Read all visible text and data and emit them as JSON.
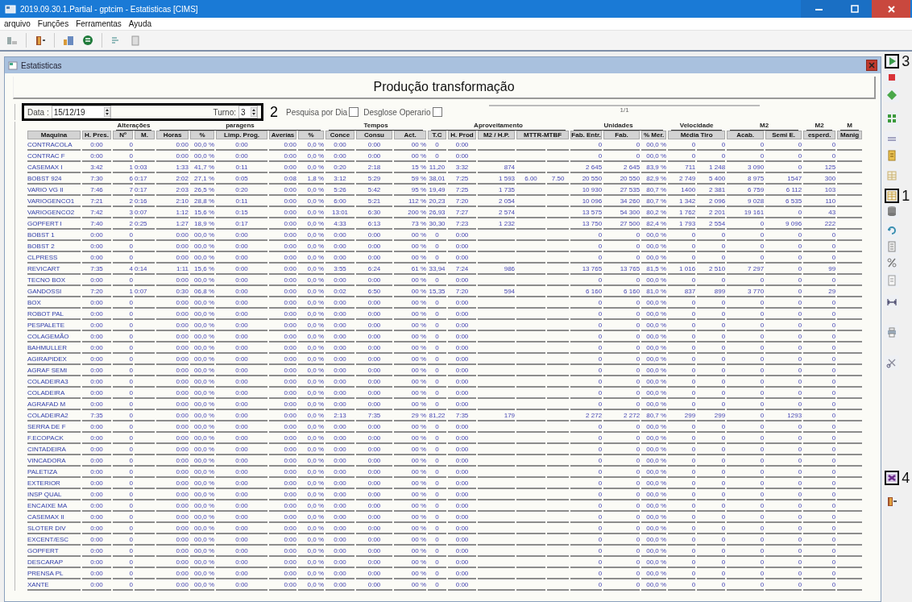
{
  "window": {
    "title": "2019.09.30.1.Partial - gptcim - Estatisticas [CIMS]"
  },
  "menu": [
    "arquivo",
    "Funções",
    "Ferramentas",
    "Ayuda"
  ],
  "child_window": {
    "title": "Estatisticas",
    "heading": "Produção transformação"
  },
  "filters": {
    "date_label": "Data :",
    "date_value": "15/12/19",
    "shift_label": "Turno:",
    "shift_value": "3",
    "highlighted": true,
    "callout": "2",
    "search_by_day": {
      "label": "Pesquisa por Dia",
      "checked": false
    },
    "operator_breakdown": {
      "label": "Desglose Operario",
      "checked": false
    },
    "page": "1/1"
  },
  "table": {
    "groups": [
      {
        "columns": [
          {
            "label": "Maquina"
          },
          {
            "label": "H. Pres."
          }
        ]
      },
      {
        "label": "Alterações",
        "columns": [
          {
            "label": "Nº"
          },
          {
            "label": "M."
          }
        ]
      },
      {
        "label": "paragens",
        "columns": [
          {
            "label": "Horas"
          },
          {
            "label": "%"
          },
          {
            "label": "Limp. Prog."
          },
          {
            "label": "Averías"
          },
          {
            "label": "%"
          }
        ]
      },
      {
        "label": "Tempos",
        "columns": [
          {
            "label": "Conce"
          },
          {
            "label": "Consu"
          },
          {
            "label": "Act."
          }
        ]
      },
      {
        "label": "Aproveitamento",
        "columns": [
          {
            "label": "T.C"
          },
          {
            "label": "H. Prod"
          },
          {
            "label": "M2 / H.P."
          },
          {
            "label": "MTTR-MTBF",
            "kind": "pair"
          }
        ]
      },
      {
        "label": "Unidades",
        "columns": [
          {
            "label": "Fab. Entr."
          },
          {
            "label": "Fab."
          },
          {
            "label": "% Mer."
          }
        ]
      },
      {
        "label": "Velocidade",
        "columns": [
          {
            "label": "Média Tiro",
            "kind": "pair"
          }
        ]
      },
      {
        "label": "M2",
        "columns": [
          {
            "label": "Acab."
          },
          {
            "label": "Semi E."
          }
        ]
      },
      {
        "label": "M2",
        "columns": [
          {
            "label": "esperd."
          }
        ]
      },
      {
        "label": "M",
        "columns": [
          {
            "label": "Manig"
          }
        ]
      }
    ],
    "rows": [
      [
        "CONTRACOLA",
        "0:00",
        "0",
        null,
        "0:00",
        "00,0 %",
        "0:00",
        "0:00",
        "0,0 %",
        "0:00",
        "0:00",
        "00 %",
        "0",
        "0:00",
        null,
        null,
        null,
        "0",
        "0",
        "00,0 %",
        "0",
        "0",
        "0",
        "0",
        "0"
      ],
      [
        "CONTRAC F",
        "0:00",
        "0",
        null,
        "0:00",
        "00,0 %",
        "0:00",
        "0:00",
        "0,0 %",
        "0:00",
        "0:00",
        "00 %",
        "0",
        "0:00",
        null,
        null,
        null,
        "0",
        "0",
        "00,0 %",
        "0",
        "0",
        "0",
        "0",
        "0"
      ],
      [
        "CASEMAX I",
        "3:42",
        "1",
        "0:03",
        "1:33",
        "41,7 %",
        "0:11",
        "0:00",
        "0,0 %",
        "0:20",
        "2:18",
        "15 %",
        "11,20",
        "3:32",
        "874",
        null,
        null,
        "2 645",
        "2 645",
        "83,9 %",
        "711",
        "1 248",
        "3 090",
        "0",
        "125"
      ],
      [
        "BOBST 924",
        "7:30",
        "6",
        "0:17",
        "2:02",
        "27,1 %",
        "0:05",
        "0:08",
        "1,8 %",
        "3:12",
        "5:29",
        "59 %",
        "38,01",
        "7:25",
        "1 593",
        "6.00",
        "7.50",
        "20 550",
        "20 550",
        "82,9 %",
        "2 749",
        "5 400",
        "8 975",
        "1547",
        "300"
      ],
      [
        "VARIO VG II",
        "7:46",
        "7",
        "0:17",
        "2:03",
        "26,5 %",
        "0:20",
        "0:00",
        "0,0 %",
        "5:26",
        "5:42",
        "95 %",
        "19,49",
        "7:25",
        "1 735",
        null,
        null,
        "10 930",
        "27 535",
        "80,7 %",
        "1400",
        "2 381",
        "6 759",
        "6 112",
        "103"
      ],
      [
        "VARIOGENCO1",
        "7:21",
        "2",
        "0:16",
        "2:10",
        "28,8 %",
        "0:11",
        "0:00",
        "0,0 %",
        "6:00",
        "5:21",
        "112 %",
        "20,23",
        "7:20",
        "2 054",
        null,
        null,
        "10 096",
        "34 260",
        "80,7 %",
        "1 342",
        "2 096",
        "9 028",
        "6 535",
        "110"
      ],
      [
        "VARIOGENCO2",
        "7:42",
        "3",
        "0:07",
        "1:12",
        "15,6 %",
        "0:15",
        "0:00",
        "0,0 %",
        "13:01",
        "6:30",
        "200 %",
        "26,93",
        "7:27",
        "2 574",
        null,
        null,
        "13 575",
        "54 300",
        "80,2 %",
        "1 762",
        "2 201",
        "19 161",
        "0",
        "43"
      ],
      [
        "GOPFERT I",
        "7:40",
        "2",
        "0:25",
        "1:27",
        "18,9 %",
        "0:17",
        "0:00",
        "0,0 %",
        "4:33",
        "6:13",
        "73 %",
        "30,30",
        "7:23",
        "1 232",
        null,
        null,
        "13 750",
        "27 500",
        "82,4 %",
        "1 793",
        "2 554",
        "0",
        "9 096",
        "222"
      ],
      [
        "BOBST 1",
        "0:00",
        "0",
        null,
        "0:00",
        "00,0 %",
        "0:00",
        "0:00",
        "0,0 %",
        "0:00",
        "0:00",
        "00 %",
        "0",
        "0:00",
        null,
        null,
        null,
        "0",
        "0",
        "00,0 %",
        "0",
        "0",
        "0",
        "0",
        "0"
      ],
      [
        "BOBST 2",
        "0:00",
        "0",
        null,
        "0:00",
        "00,0 %",
        "0:00",
        "0:00",
        "0,0 %",
        "0:00",
        "0:00",
        "00 %",
        "0",
        "0:00",
        null,
        null,
        null,
        "0",
        "0",
        "00,0 %",
        "0",
        "0",
        "0",
        "0",
        "0"
      ],
      [
        "CLPRESS",
        "0:00",
        "0",
        null,
        "0:00",
        "00,0 %",
        "0:00",
        "0:00",
        "0,0 %",
        "0:00",
        "0:00",
        "00 %",
        "0",
        "0:00",
        null,
        null,
        null,
        "0",
        "0",
        "00,0 %",
        "0",
        "0",
        "0",
        "0",
        "0"
      ],
      [
        "REVICART",
        "7:35",
        "4",
        "0:14",
        "1:11",
        "15,6 %",
        "0:00",
        "0:00",
        "0,0 %",
        "3:55",
        "6:24",
        "61 %",
        "33,94",
        "7:24",
        "986",
        null,
        null,
        "13 765",
        "13 765",
        "81,5 %",
        "1 016",
        "2 510",
        "7 297",
        "0",
        "99"
      ],
      [
        "TECNO BOX",
        "0:00",
        "0",
        null,
        "0:00",
        "00,0 %",
        "0:00",
        "0:00",
        "0,0 %",
        "0:00",
        "0:00",
        "00 %",
        "0",
        "0:00",
        null,
        null,
        null,
        "0",
        "0",
        "00,0 %",
        "0",
        "0",
        "0",
        "0",
        "0"
      ],
      [
        "GANDOSSI",
        "7:20",
        "1",
        "0:07",
        "0:30",
        "06,8 %",
        "0:00",
        "0:00",
        "0,0 %",
        "0:02",
        "6:50",
        "00 %",
        "15,35",
        "7:20",
        "594",
        null,
        null,
        "6 160",
        "6 160",
        "81,0 %",
        "837",
        "899",
        "3 770",
        "0",
        "29"
      ],
      [
        "BOX",
        "0:00",
        "0",
        null,
        "0:00",
        "00,0 %",
        "0:00",
        "0:00",
        "0,0 %",
        "0:00",
        "0:00",
        "00 %",
        "0",
        "0:00",
        null,
        null,
        null,
        "0",
        "0",
        "00,0 %",
        "0",
        "0",
        "0",
        "0",
        "0"
      ],
      [
        "ROBOT PAL",
        "0:00",
        "0",
        null,
        "0:00",
        "00,0 %",
        "0:00",
        "0:00",
        "0,0 %",
        "0:00",
        "0:00",
        "00 %",
        "0",
        "0:00",
        null,
        null,
        null,
        "0",
        "0",
        "00,0 %",
        "0",
        "0",
        "0",
        "0",
        "0"
      ],
      [
        "PESPALETE",
        "0:00",
        "0",
        null,
        "0:00",
        "00,0 %",
        "0:00",
        "0:00",
        "0,0 %",
        "0:00",
        "0:00",
        "00 %",
        "0",
        "0:00",
        null,
        null,
        null,
        "0",
        "0",
        "00,0 %",
        "0",
        "0",
        "0",
        "0",
        "0"
      ],
      [
        "COLAGEMÃO",
        "0:00",
        "0",
        null,
        "0:00",
        "00,0 %",
        "0:00",
        "0:00",
        "0,0 %",
        "0:00",
        "0:00",
        "00 %",
        "0",
        "0:00",
        null,
        null,
        null,
        "0",
        "0",
        "00,0 %",
        "0",
        "0",
        "0",
        "0",
        "0"
      ],
      [
        "BAHMULLER",
        "0:00",
        "0",
        null,
        "0:00",
        "00,0 %",
        "0:00",
        "0:00",
        "0,0 %",
        "0:00",
        "0:00",
        "00 %",
        "0",
        "0:00",
        null,
        null,
        null,
        "0",
        "0",
        "00,0 %",
        "0",
        "0",
        "0",
        "0",
        "0"
      ],
      [
        "AGIRAPIDEX",
        "0:00",
        "0",
        null,
        "0:00",
        "00,0 %",
        "0:00",
        "0:00",
        "0,0 %",
        "0:00",
        "0:00",
        "00 %",
        "0",
        "0:00",
        null,
        null,
        null,
        "0",
        "0",
        "00,0 %",
        "0",
        "0",
        "0",
        "0",
        "0"
      ],
      [
        "AGRAF SEMI",
        "0:00",
        "0",
        null,
        "0:00",
        "00,0 %",
        "0:00",
        "0:00",
        "0,0 %",
        "0:00",
        "0:00",
        "00 %",
        "0",
        "0:00",
        null,
        null,
        null,
        "0",
        "0",
        "00,0 %",
        "0",
        "0",
        "0",
        "0",
        "0"
      ],
      [
        "COLADEIRA3",
        "0:00",
        "0",
        null,
        "0:00",
        "00,0 %",
        "0:00",
        "0:00",
        "0,0 %",
        "0:00",
        "0:00",
        "00 %",
        "0",
        "0:00",
        null,
        null,
        null,
        "0",
        "0",
        "00,0 %",
        "0",
        "0",
        "0",
        "0",
        "0"
      ],
      [
        "COLADEIRA",
        "0:00",
        "0",
        null,
        "0:00",
        "00,0 %",
        "0:00",
        "0:00",
        "0,0 %",
        "0:00",
        "0:00",
        "00 %",
        "0",
        "0:00",
        null,
        null,
        null,
        "0",
        "0",
        "00,0 %",
        "0",
        "0",
        "0",
        "0",
        "0"
      ],
      [
        "AGRAFAD M",
        "0:00",
        "0",
        null,
        "0:00",
        "00,0 %",
        "0:00",
        "0:00",
        "0,0 %",
        "0:00",
        "0:00",
        "00 %",
        "0",
        "0:00",
        null,
        null,
        null,
        "0",
        "0",
        "00,0 %",
        "0",
        "0",
        "0",
        "0",
        "0"
      ],
      [
        "COLADEIRA2",
        "7:35",
        "0",
        null,
        "0:00",
        "00,0 %",
        "0:00",
        "0:00",
        "0,0 %",
        "2:13",
        "7:35",
        "29 %",
        "81,22",
        "7:35",
        "179",
        null,
        null,
        "2 272",
        "2 272",
        "80,7 %",
        "299",
        "299",
        "0",
        "1293",
        "0"
      ],
      [
        "SERRA DE F",
        "0:00",
        "0",
        null,
        "0:00",
        "00,0 %",
        "0:00",
        "0:00",
        "0,0 %",
        "0:00",
        "0:00",
        "00 %",
        "0",
        "0:00",
        null,
        null,
        null,
        "0",
        "0",
        "00,0 %",
        "0",
        "0",
        "0",
        "0",
        "0"
      ],
      [
        "F.ECOPACK",
        "0:00",
        "0",
        null,
        "0:00",
        "00,0 %",
        "0:00",
        "0:00",
        "0,0 %",
        "0:00",
        "0:00",
        "00 %",
        "0",
        "0:00",
        null,
        null,
        null,
        "0",
        "0",
        "00,0 %",
        "0",
        "0",
        "0",
        "0",
        "0"
      ],
      [
        "CINTADEIRA",
        "0:00",
        "0",
        null,
        "0:00",
        "00,0 %",
        "0:00",
        "0:00",
        "0,0 %",
        "0:00",
        "0:00",
        "00 %",
        "0",
        "0:00",
        null,
        null,
        null,
        "0",
        "0",
        "00,0 %",
        "0",
        "0",
        "0",
        "0",
        "0"
      ],
      [
        "VINCADORA",
        "0:00",
        "0",
        null,
        "0:00",
        "00,0 %",
        "0:00",
        "0:00",
        "0,0 %",
        "0:00",
        "0:00",
        "00 %",
        "0",
        "0:00",
        null,
        null,
        null,
        "0",
        "0",
        "00,0 %",
        "0",
        "0",
        "0",
        "0",
        "0"
      ],
      [
        "PALETIZA",
        "0:00",
        "0",
        null,
        "0:00",
        "00,0 %",
        "0:00",
        "0:00",
        "0,0 %",
        "0:00",
        "0:00",
        "00 %",
        "0",
        "0:00",
        null,
        null,
        null,
        "0",
        "0",
        "00,0 %",
        "0",
        "0",
        "0",
        "0",
        "0"
      ],
      [
        "EXTERIOR",
        "0:00",
        "0",
        null,
        "0:00",
        "00,0 %",
        "0:00",
        "0:00",
        "0,0 %",
        "0:00",
        "0:00",
        "00 %",
        "0",
        "0:00",
        null,
        null,
        null,
        "0",
        "0",
        "00,0 %",
        "0",
        "0",
        "0",
        "0",
        "0"
      ],
      [
        "INSP QUAL",
        "0:00",
        "0",
        null,
        "0:00",
        "00,0 %",
        "0:00",
        "0:00",
        "0,0 %",
        "0:00",
        "0:00",
        "00 %",
        "0",
        "0:00",
        null,
        null,
        null,
        "0",
        "0",
        "00,0 %",
        "0",
        "0",
        "0",
        "0",
        "0"
      ],
      [
        "ENCAIXE MA",
        "0:00",
        "0",
        null,
        "0:00",
        "00,0 %",
        "0:00",
        "0:00",
        "0,0 %",
        "0:00",
        "0:00",
        "00 %",
        "0",
        "0:00",
        null,
        null,
        null,
        "0",
        "0",
        "00,0 %",
        "0",
        "0",
        "0",
        "0",
        "0"
      ],
      [
        "CASEMAX II",
        "0:00",
        "0",
        null,
        "0:00",
        "00,0 %",
        "0:00",
        "0:00",
        "0,0 %",
        "0:00",
        "0:00",
        "00 %",
        "0",
        "0:00",
        null,
        null,
        null,
        "0",
        "0",
        "00,0 %",
        "0",
        "0",
        "0",
        "0",
        "0"
      ],
      [
        "SLOTER DIV",
        "0:00",
        "0",
        null,
        "0:00",
        "00,0 %",
        "0:00",
        "0:00",
        "0,0 %",
        "0:00",
        "0:00",
        "00 %",
        "0",
        "0:00",
        null,
        null,
        null,
        "0",
        "0",
        "00,0 %",
        "0",
        "0",
        "0",
        "0",
        "0"
      ],
      [
        "EXCENT/ESC",
        "0:00",
        "0",
        null,
        "0:00",
        "00,0 %",
        "0:00",
        "0:00",
        "0,0 %",
        "0:00",
        "0:00",
        "00 %",
        "0",
        "0:00",
        null,
        null,
        null,
        "0",
        "0",
        "00,0 %",
        "0",
        "0",
        "0",
        "0",
        "0"
      ],
      [
        "GOPFERT",
        "0:00",
        "0",
        null,
        "0:00",
        "00,0 %",
        "0:00",
        "0:00",
        "0,0 %",
        "0:00",
        "0:00",
        "00 %",
        "0",
        "0:00",
        null,
        null,
        null,
        "0",
        "0",
        "00,0 %",
        "0",
        "0",
        "0",
        "0",
        "0"
      ],
      [
        "DESCARAP",
        "0:00",
        "0",
        null,
        "0:00",
        "00,0 %",
        "0:00",
        "0:00",
        "0,0 %",
        "0:00",
        "0:00",
        "00 %",
        "0",
        "0:00",
        null,
        null,
        null,
        "0",
        "0",
        "00,0 %",
        "0",
        "0",
        "0",
        "0",
        "0"
      ],
      [
        "PRENSA PL",
        "0:00",
        "0",
        null,
        "0:00",
        "00,0 %",
        "0:00",
        "0:00",
        "0,0 %",
        "0:00",
        "0:00",
        "00 %",
        "0",
        "0:00",
        null,
        null,
        null,
        "0",
        "0",
        "00,0 %",
        "0",
        "0",
        "0",
        "0",
        "0"
      ],
      [
        "XANTE",
        "0:00",
        "0",
        null,
        "0:00",
        "00,0 %",
        "0:00",
        "0:00",
        "0,0 %",
        "0:00",
        "0:00",
        "00 %",
        "0",
        "0:00",
        null,
        null,
        null,
        "0",
        "0",
        "00,0 %",
        "0",
        "0",
        "0",
        "0",
        "0"
      ]
    ]
  },
  "side_toolbar": [
    {
      "highlighted": true,
      "callout": "3"
    },
    {
      "highlighted": false
    },
    {
      "highlighted": false
    },
    {
      "highlighted": false
    },
    {
      "highlighted": false
    },
    {
      "highlighted": false
    },
    {
      "highlighted": false
    },
    {
      "highlighted": true,
      "callout": "1"
    },
    {
      "highlighted": false
    },
    {
      "highlighted": false
    },
    {
      "highlighted": false
    },
    {
      "highlighted": false
    },
    {
      "highlighted": false
    },
    {
      "highlighted": false
    },
    {
      "highlighted": false
    },
    {
      "highlighted": false
    },
    {
      "highlighted": true,
      "callout": "4"
    },
    {
      "highlighted": false
    }
  ]
}
